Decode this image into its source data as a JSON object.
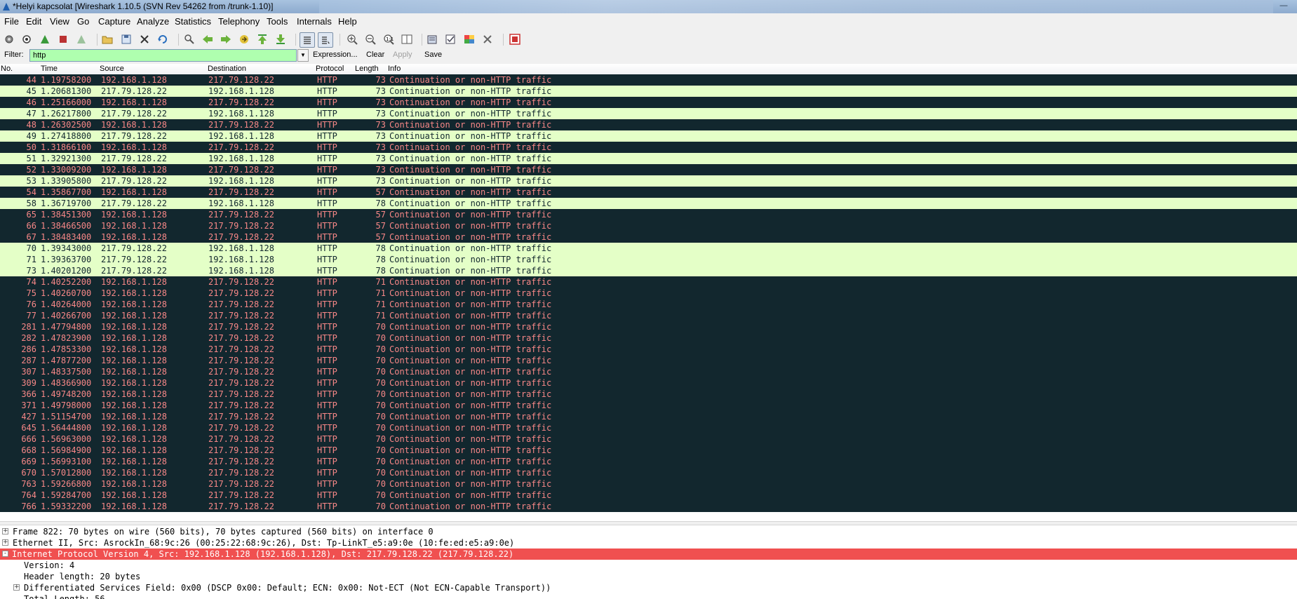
{
  "window": {
    "title": "*Helyi kapcsolat  [Wireshark 1.10.5  (SVN Rev 54262 from /trunk-1.10)]"
  },
  "menu": [
    "File",
    "Edit",
    "View",
    "Go",
    "Capture",
    "Analyze",
    "Statistics",
    "Telephony",
    "Tools",
    "Internals",
    "Help"
  ],
  "toolbar_icons": [
    "interface-list-icon",
    "capture-options-icon",
    "start-capture-icon",
    "stop-capture-icon",
    "restart-capture-icon",
    "open-file-icon",
    "save-file-icon",
    "close-file-icon",
    "reload-icon",
    "find-packet-icon",
    "go-back-icon",
    "go-forward-icon",
    "go-to-packet-icon",
    "go-first-icon",
    "go-last-icon",
    "colorize-icon",
    "auto-scroll-icon",
    "zoom-in-icon",
    "zoom-out-icon",
    "normal-size-icon",
    "resize-columns-icon",
    "capture-filters-icon",
    "display-filters-icon",
    "coloring-rules-icon",
    "preferences-icon",
    "help-icon"
  ],
  "filter": {
    "label": "Filter:",
    "value": "http",
    "expression_label": "Expression...",
    "clear_label": "Clear",
    "apply_label": "Apply",
    "save_label": "Save"
  },
  "columns": {
    "no": "No.",
    "time": "Time",
    "source": "Source",
    "destination": "Destination",
    "protocol": "Protocol",
    "length": "Length",
    "info": "Info"
  },
  "packets": [
    {
      "no": "44",
      "time": "1.19758200",
      "src": "192.168.1.128",
      "dst": "217.79.128.22",
      "proto": "HTTP",
      "len": "73",
      "info": "Continuation or non-HTTP traffic",
      "dir": "req"
    },
    {
      "no": "45",
      "time": "1.20681300",
      "src": "217.79.128.22",
      "dst": "192.168.1.128",
      "proto": "HTTP",
      "len": "73",
      "info": "Continuation or non-HTTP traffic",
      "dir": "resp"
    },
    {
      "no": "46",
      "time": "1.25166000",
      "src": "192.168.1.128",
      "dst": "217.79.128.22",
      "proto": "HTTP",
      "len": "73",
      "info": "Continuation or non-HTTP traffic",
      "dir": "req"
    },
    {
      "no": "47",
      "time": "1.26217800",
      "src": "217.79.128.22",
      "dst": "192.168.1.128",
      "proto": "HTTP",
      "len": "73",
      "info": "Continuation or non-HTTP traffic",
      "dir": "resp"
    },
    {
      "no": "48",
      "time": "1.26302500",
      "src": "192.168.1.128",
      "dst": "217.79.128.22",
      "proto": "HTTP",
      "len": "73",
      "info": "Continuation or non-HTTP traffic",
      "dir": "req"
    },
    {
      "no": "49",
      "time": "1.27418800",
      "src": "217.79.128.22",
      "dst": "192.168.1.128",
      "proto": "HTTP",
      "len": "73",
      "info": "Continuation or non-HTTP traffic",
      "dir": "resp"
    },
    {
      "no": "50",
      "time": "1.31866100",
      "src": "192.168.1.128",
      "dst": "217.79.128.22",
      "proto": "HTTP",
      "len": "73",
      "info": "Continuation or non-HTTP traffic",
      "dir": "req"
    },
    {
      "no": "51",
      "time": "1.32921300",
      "src": "217.79.128.22",
      "dst": "192.168.1.128",
      "proto": "HTTP",
      "len": "73",
      "info": "Continuation or non-HTTP traffic",
      "dir": "resp"
    },
    {
      "no": "52",
      "time": "1.33009200",
      "src": "192.168.1.128",
      "dst": "217.79.128.22",
      "proto": "HTTP",
      "len": "73",
      "info": "Continuation or non-HTTP traffic",
      "dir": "req"
    },
    {
      "no": "53",
      "time": "1.33905800",
      "src": "217.79.128.22",
      "dst": "192.168.1.128",
      "proto": "HTTP",
      "len": "73",
      "info": "Continuation or non-HTTP traffic",
      "dir": "resp"
    },
    {
      "no": "54",
      "time": "1.35867700",
      "src": "192.168.1.128",
      "dst": "217.79.128.22",
      "proto": "HTTP",
      "len": "57",
      "info": "Continuation or non-HTTP traffic",
      "dir": "req"
    },
    {
      "no": "58",
      "time": "1.36719700",
      "src": "217.79.128.22",
      "dst": "192.168.1.128",
      "proto": "HTTP",
      "len": "78",
      "info": "Continuation or non-HTTP traffic",
      "dir": "resp"
    },
    {
      "no": "65",
      "time": "1.38451300",
      "src": "192.168.1.128",
      "dst": "217.79.128.22",
      "proto": "HTTP",
      "len": "57",
      "info": "Continuation or non-HTTP traffic",
      "dir": "req"
    },
    {
      "no": "66",
      "time": "1.38466500",
      "src": "192.168.1.128",
      "dst": "217.79.128.22",
      "proto": "HTTP",
      "len": "57",
      "info": "Continuation or non-HTTP traffic",
      "dir": "req"
    },
    {
      "no": "67",
      "time": "1.38483400",
      "src": "192.168.1.128",
      "dst": "217.79.128.22",
      "proto": "HTTP",
      "len": "57",
      "info": "Continuation or non-HTTP traffic",
      "dir": "req"
    },
    {
      "no": "70",
      "time": "1.39343000",
      "src": "217.79.128.22",
      "dst": "192.168.1.128",
      "proto": "HTTP",
      "len": "78",
      "info": "Continuation or non-HTTP traffic",
      "dir": "resp"
    },
    {
      "no": "71",
      "time": "1.39363700",
      "src": "217.79.128.22",
      "dst": "192.168.1.128",
      "proto": "HTTP",
      "len": "78",
      "info": "Continuation or non-HTTP traffic",
      "dir": "resp"
    },
    {
      "no": "73",
      "time": "1.40201200",
      "src": "217.79.128.22",
      "dst": "192.168.1.128",
      "proto": "HTTP",
      "len": "78",
      "info": "Continuation or non-HTTP traffic",
      "dir": "resp"
    },
    {
      "no": "74",
      "time": "1.40252200",
      "src": "192.168.1.128",
      "dst": "217.79.128.22",
      "proto": "HTTP",
      "len": "71",
      "info": "Continuation or non-HTTP traffic",
      "dir": "req"
    },
    {
      "no": "75",
      "time": "1.40260700",
      "src": "192.168.1.128",
      "dst": "217.79.128.22",
      "proto": "HTTP",
      "len": "71",
      "info": "Continuation or non-HTTP traffic",
      "dir": "req"
    },
    {
      "no": "76",
      "time": "1.40264000",
      "src": "192.168.1.128",
      "dst": "217.79.128.22",
      "proto": "HTTP",
      "len": "71",
      "info": "Continuation or non-HTTP traffic",
      "dir": "req"
    },
    {
      "no": "77",
      "time": "1.40266700",
      "src": "192.168.1.128",
      "dst": "217.79.128.22",
      "proto": "HTTP",
      "len": "71",
      "info": "Continuation or non-HTTP traffic",
      "dir": "req"
    },
    {
      "no": "281",
      "time": "1.47794800",
      "src": "192.168.1.128",
      "dst": "217.79.128.22",
      "proto": "HTTP",
      "len": "70",
      "info": "Continuation or non-HTTP traffic",
      "dir": "req"
    },
    {
      "no": "282",
      "time": "1.47823900",
      "src": "192.168.1.128",
      "dst": "217.79.128.22",
      "proto": "HTTP",
      "len": "70",
      "info": "Continuation or non-HTTP traffic",
      "dir": "req"
    },
    {
      "no": "286",
      "time": "1.47853300",
      "src": "192.168.1.128",
      "dst": "217.79.128.22",
      "proto": "HTTP",
      "len": "70",
      "info": "Continuation or non-HTTP traffic",
      "dir": "req"
    },
    {
      "no": "287",
      "time": "1.47877200",
      "src": "192.168.1.128",
      "dst": "217.79.128.22",
      "proto": "HTTP",
      "len": "70",
      "info": "Continuation or non-HTTP traffic",
      "dir": "req"
    },
    {
      "no": "307",
      "time": "1.48337500",
      "src": "192.168.1.128",
      "dst": "217.79.128.22",
      "proto": "HTTP",
      "len": "70",
      "info": "Continuation or non-HTTP traffic",
      "dir": "req"
    },
    {
      "no": "309",
      "time": "1.48366900",
      "src": "192.168.1.128",
      "dst": "217.79.128.22",
      "proto": "HTTP",
      "len": "70",
      "info": "Continuation or non-HTTP traffic",
      "dir": "req"
    },
    {
      "no": "366",
      "time": "1.49748200",
      "src": "192.168.1.128",
      "dst": "217.79.128.22",
      "proto": "HTTP",
      "len": "70",
      "info": "Continuation or non-HTTP traffic",
      "dir": "req"
    },
    {
      "no": "371",
      "time": "1.49798000",
      "src": "192.168.1.128",
      "dst": "217.79.128.22",
      "proto": "HTTP",
      "len": "70",
      "info": "Continuation or non-HTTP traffic",
      "dir": "req"
    },
    {
      "no": "427",
      "time": "1.51154700",
      "src": "192.168.1.128",
      "dst": "217.79.128.22",
      "proto": "HTTP",
      "len": "70",
      "info": "Continuation or non-HTTP traffic",
      "dir": "req"
    },
    {
      "no": "645",
      "time": "1.56444800",
      "src": "192.168.1.128",
      "dst": "217.79.128.22",
      "proto": "HTTP",
      "len": "70",
      "info": "Continuation or non-HTTP traffic",
      "dir": "req"
    },
    {
      "no": "666",
      "time": "1.56963000",
      "src": "192.168.1.128",
      "dst": "217.79.128.22",
      "proto": "HTTP",
      "len": "70",
      "info": "Continuation or non-HTTP traffic",
      "dir": "req"
    },
    {
      "no": "668",
      "time": "1.56984900",
      "src": "192.168.1.128",
      "dst": "217.79.128.22",
      "proto": "HTTP",
      "len": "70",
      "info": "Continuation or non-HTTP traffic",
      "dir": "req"
    },
    {
      "no": "669",
      "time": "1.56993100",
      "src": "192.168.1.128",
      "dst": "217.79.128.22",
      "proto": "HTTP",
      "len": "70",
      "info": "Continuation or non-HTTP traffic",
      "dir": "req"
    },
    {
      "no": "670",
      "time": "1.57012800",
      "src": "192.168.1.128",
      "dst": "217.79.128.22",
      "proto": "HTTP",
      "len": "70",
      "info": "Continuation or non-HTTP traffic",
      "dir": "req"
    },
    {
      "no": "763",
      "time": "1.59266800",
      "src": "192.168.1.128",
      "dst": "217.79.128.22",
      "proto": "HTTP",
      "len": "70",
      "info": "Continuation or non-HTTP traffic",
      "dir": "req"
    },
    {
      "no": "764",
      "time": "1.59284700",
      "src": "192.168.1.128",
      "dst": "217.79.128.22",
      "proto": "HTTP",
      "len": "70",
      "info": "Continuation or non-HTTP traffic",
      "dir": "req"
    },
    {
      "no": "766",
      "time": "1.59332200",
      "src": "192.168.1.128",
      "dst": "217.79.128.22",
      "proto": "HTTP",
      "len": "70",
      "info": "Continuation or non-HTTP traffic",
      "dir": "req"
    }
  ],
  "details": [
    {
      "text": "Frame 822: 70 bytes on wire (560 bits), 70 bytes captured (560 bits) on interface 0",
      "expander": "+",
      "level": 0,
      "selected": false
    },
    {
      "text": "Ethernet II, Src: AsrockIn_68:9c:26 (00:25:22:68:9c:26), Dst: Tp-LinkT_e5:a9:0e (10:fe:ed:e5:a9:0e)",
      "expander": "+",
      "level": 0,
      "selected": false
    },
    {
      "text": "Internet Protocol Version 4, Src: 192.168.1.128 (192.168.1.128), Dst: 217.79.128.22 (217.79.128.22)",
      "expander": "-",
      "level": 0,
      "selected": true
    },
    {
      "text": "Version: 4",
      "expander": "",
      "level": 1,
      "selected": false
    },
    {
      "text": "Header length: 20 bytes",
      "expander": "",
      "level": 1,
      "selected": false
    },
    {
      "text": "Differentiated Services Field: 0x00 (DSCP 0x00: Default; ECN: 0x00: Not-ECT (Not ECN-Capable Transport))",
      "expander": "+",
      "level": 1,
      "selected": false
    },
    {
      "text": "Total Length: 56",
      "expander": "",
      "level": 1,
      "selected": false
    }
  ],
  "colors": {
    "request_row_bg": "#12272e",
    "request_row_fg": "#f78787",
    "response_row_bg": "#e4ffc7",
    "response_row_fg": "#12272e",
    "filter_valid_bg": "#afffaf",
    "selected_detail_bg": "#f05050"
  }
}
